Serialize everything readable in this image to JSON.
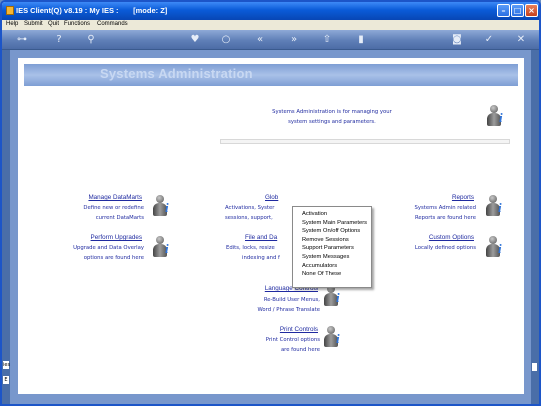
{
  "window": {
    "title": "IES Client(Q) v8.19 : My IES :       [mode: Z]"
  },
  "menubar": {
    "items": [
      "Help",
      "Submit",
      "Quit",
      "Functions",
      "Commands"
    ]
  },
  "toolbar": {
    "icons": [
      "key-icon",
      "help-icon",
      "search-icon",
      "heart-icon",
      "circle-icon",
      "rewind-icon",
      "fast-forward-icon",
      "upload-icon",
      "pause-icon",
      "save-icon",
      "checkmark-icon",
      "close-icon"
    ]
  },
  "banner": {
    "title": "Systems Administration"
  },
  "intro": {
    "line1": "Systems Administration is for managing your",
    "line2": "system settings and parameters."
  },
  "tiles": {
    "manage_datamarts": {
      "title": "Manage DataMarts",
      "line1": "Define new or redefine",
      "line2": "current DataMarts"
    },
    "perform_upgrades": {
      "title": "Perform Upgrades",
      "line1": "Upgrade and Data Overlay",
      "line2": "options are found here"
    },
    "global": {
      "title": "Glob",
      "line1": "Activations, Syster",
      "line2": "sessions, support,"
    },
    "file_and_data": {
      "title": "File and Da",
      "line1": "Edits, locks, resize",
      "line2": "indexing and f"
    },
    "reports": {
      "title": "Reports",
      "line1": "Systems Admin related",
      "line2": "Reports are found here"
    },
    "custom_options": {
      "title": "Custom Options",
      "line1": "Locally defined options"
    },
    "language_controls": {
      "title": "Language Controls",
      "line1": "Re-Build User Menus,",
      "line2": "Word / Phrase Translate"
    },
    "print_controls": {
      "title": "Print Controls",
      "line1": "Print Control options",
      "line2": "are found here"
    }
  },
  "context_menu": {
    "items": [
      "Activation",
      "System Main Parameters",
      "System On/off Options",
      "Remove Sessions",
      "Support Parameters",
      "System Messages",
      "Accumulators",
      "None Of These"
    ]
  },
  "side_tags": {
    "left_top": "ies",
    "left_bottom": "E"
  }
}
